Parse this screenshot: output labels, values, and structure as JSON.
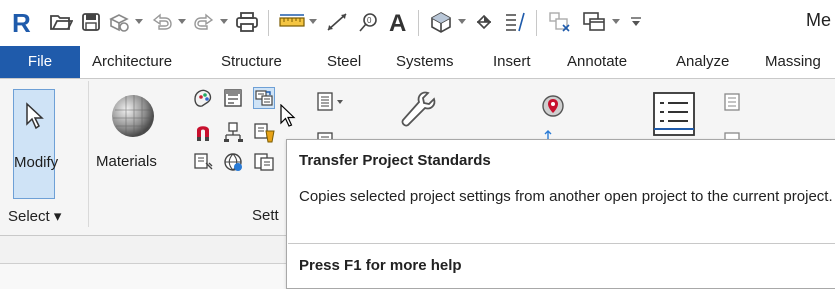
{
  "quick_access": {
    "app_title": "Me",
    "icons": [
      "revit-logo-icon",
      "open-icon",
      "save-icon",
      "sync-icon",
      "undo-icon",
      "redo-icon",
      "print-icon",
      "measure-icon",
      "dimension-icon",
      "tag-icon",
      "text-icon",
      "3d-view-icon",
      "section-icon",
      "thin-lines-icon",
      "close-windows-icon",
      "switch-windows-icon",
      "customize-icon"
    ]
  },
  "tabs": {
    "file": "File",
    "architecture": "Architecture",
    "structure": "Structure",
    "steel": "Steel",
    "systems": "Systems",
    "insert": "Insert",
    "annotate": "Annotate",
    "analyze": "Analyze",
    "massing": "Massing"
  },
  "ribbon": {
    "modify_label": "Modify",
    "materials_label": "Materials",
    "select_label": "Select ▾",
    "settings_label": "Sett"
  },
  "properties_stub": "Properties",
  "tooltip": {
    "title": "Transfer Project Standards",
    "description": "Copies selected project settings from another open project to the current project.",
    "help": "Press F1 for more help"
  },
  "colors": {
    "accent": "#1f5bab",
    "highlight": "#cfe3f6"
  }
}
